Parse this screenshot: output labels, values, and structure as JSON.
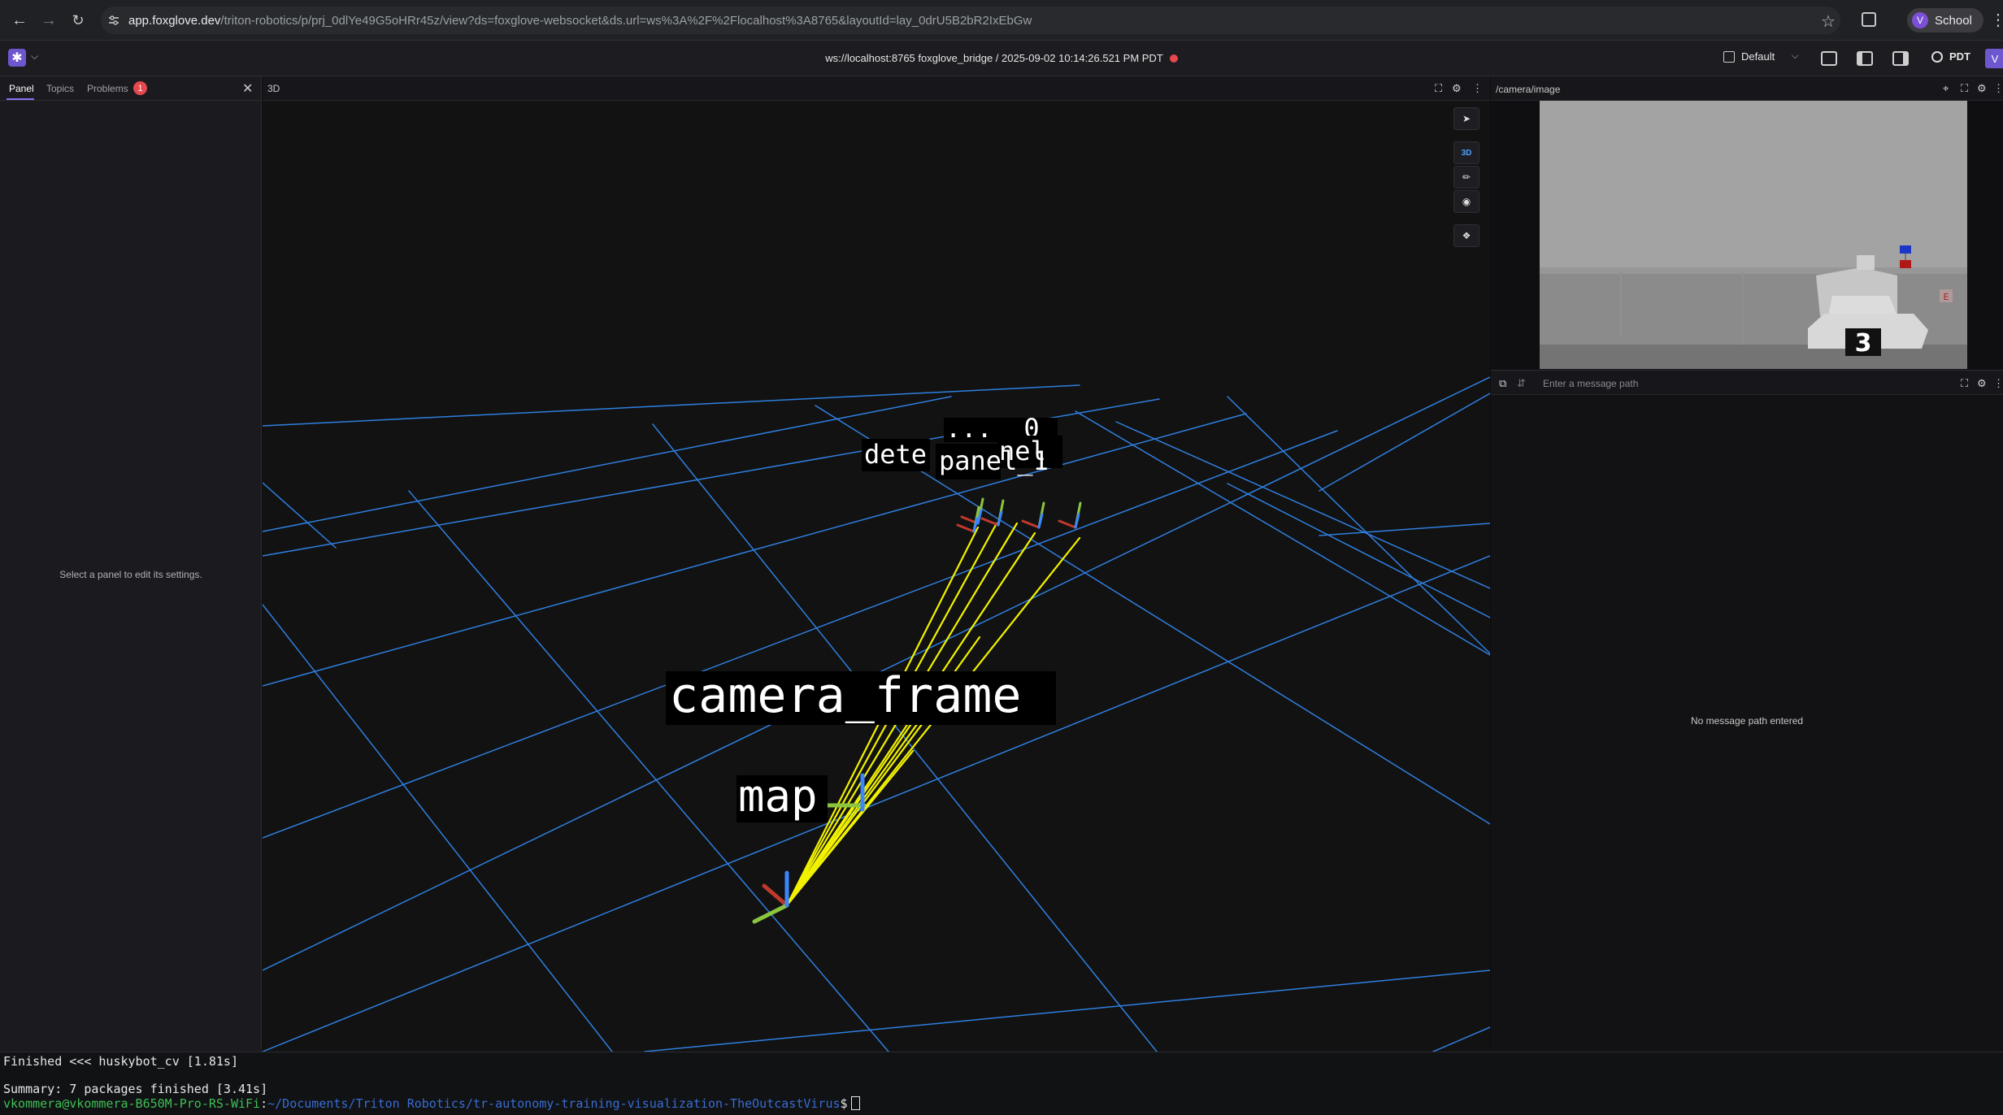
{
  "browser": {
    "url_host": "app.foxglove.dev",
    "url_path": "/triton-robotics/p/prj_0dlYe49G5oHRr45z/view?ds=foxglove-websocket&ds.url=ws%3A%2F%2Flocalhost%3A8765&layoutId=lay_0drU5B2bR2IxEbGw",
    "profile_initial": "V",
    "profile_name": "School"
  },
  "app": {
    "connection_text": "ws://localhost:8765 foxglove_bridge / 2025-09-02 10:14:26.521 PM PDT",
    "layout_label": "Default",
    "timezone_label": "PDT",
    "user_initial": "V",
    "accent_color": "#6e56cf",
    "error_color": "#e5484d"
  },
  "sidebar": {
    "tabs": [
      "Panel",
      "Topics",
      "Problems"
    ],
    "problems_count": "1",
    "empty_message": "Select a panel to edit its settings."
  },
  "panel3d": {
    "title": "3D",
    "mode_label": "3D",
    "frame_labels": {
      "camera_frame": "camera_frame",
      "map": "map",
      "panel_1": "panel_1",
      "detection_prefix": "dete",
      "detection_suffix": "nel",
      "hidden_label": "... _0"
    },
    "grid_color": "#2f7fe0",
    "axis_colors": {
      "x": "#c0392b",
      "y": "#8cc63f",
      "z": "#3a86ff"
    },
    "link_color": "#f2f200"
  },
  "camera_panel": {
    "title": "/camera/image",
    "plate_number": "3",
    "plate_side": "E"
  },
  "plot_panel": {
    "placeholder": "Enter a message path",
    "empty_message": "No message path entered"
  },
  "terminal": {
    "line1": "Finished <<< huskybot_cv [1.81s]",
    "line2": "Summary: 7 packages finished [3.41s]",
    "prompt_user": "vkommera@vkommera-B650M-Pro-RS-WiFi",
    "prompt_path": "~/Documents/Triton Robotics/tr-autonomy-training-visualization-TheOutcastVirus",
    "prompt_symbol": "$"
  }
}
